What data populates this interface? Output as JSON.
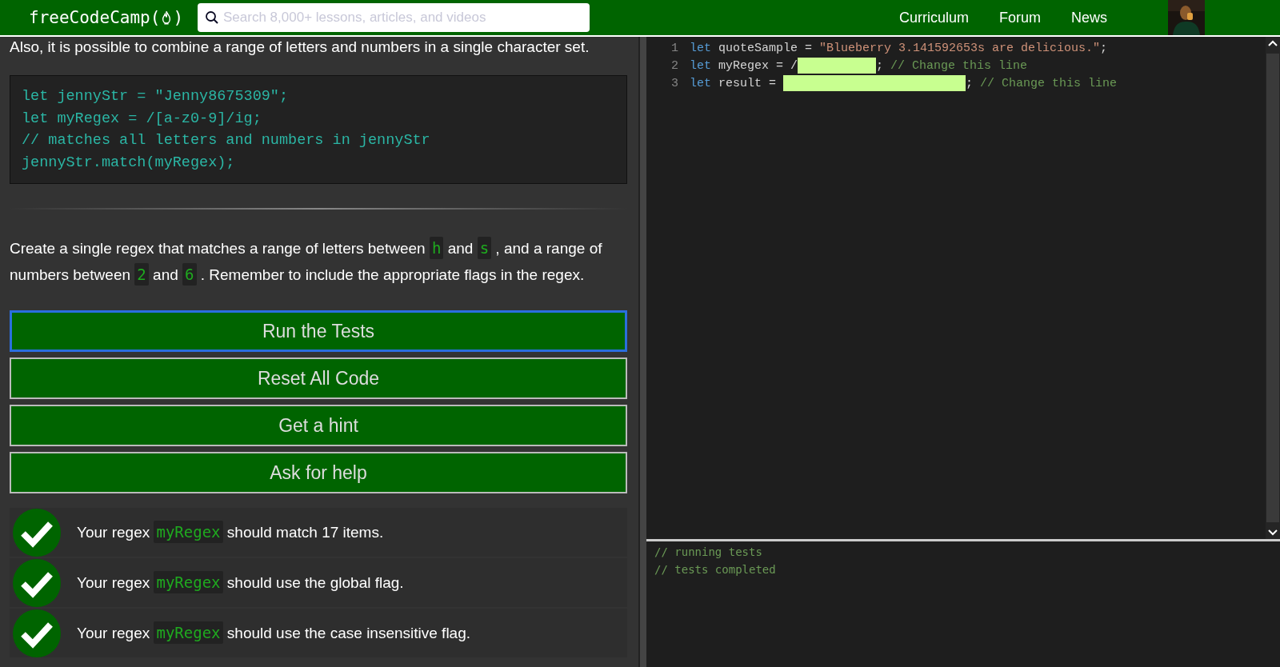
{
  "header": {
    "logo": "freeCodeCamp(",
    "logo_end": ")",
    "search": {
      "placeholder": "Search 8,000+ lessons, articles, and videos"
    },
    "nav": [
      "Curriculum",
      "Forum",
      "News"
    ]
  },
  "lesson": {
    "intro": "Also, it is possible to combine a range of letters and numbers in a single character set.",
    "example": [
      "let jennyStr = \"Jenny8675309\";",
      "let myRegex = /[a-z0-9]/ig;",
      "// matches all letters and numbers in jennyStr",
      "jennyStr.match(myRegex);"
    ],
    "instructions": [
      {
        "kind": "text",
        "text": "Create a single regex that matches a range of letters between "
      },
      {
        "kind": "code",
        "text": "h"
      },
      {
        "kind": "text",
        "text": " and "
      },
      {
        "kind": "code",
        "text": "s"
      },
      {
        "kind": "text",
        "text": " , and a range of numbers between "
      },
      {
        "kind": "code",
        "text": "2"
      },
      {
        "kind": "text",
        "text": " and "
      },
      {
        "kind": "code",
        "text": "6"
      },
      {
        "kind": "text",
        "text": " . Remember to include the appropriate flags in the regex."
      }
    ],
    "buttons": [
      {
        "label": "Run the Tests",
        "focused": true
      },
      {
        "label": "Reset All Code",
        "focused": false
      },
      {
        "label": "Get a hint",
        "focused": false
      },
      {
        "label": "Ask for help",
        "focused": false
      }
    ],
    "tests": [
      {
        "passed": true,
        "parts": [
          {
            "kind": "text",
            "text": "Your regex "
          },
          {
            "kind": "code",
            "text": "myRegex"
          },
          {
            "kind": "text",
            "text": " should match 17 items."
          }
        ]
      },
      {
        "passed": true,
        "parts": [
          {
            "kind": "text",
            "text": "Your regex "
          },
          {
            "kind": "code",
            "text": "myRegex"
          },
          {
            "kind": "text",
            "text": " should use the global flag."
          }
        ]
      },
      {
        "passed": true,
        "parts": [
          {
            "kind": "text",
            "text": "Your regex "
          },
          {
            "kind": "code",
            "text": "myRegex"
          },
          {
            "kind": "text",
            "text": " should use the case insensitive flag."
          }
        ]
      }
    ]
  },
  "editor": {
    "lines": [
      {
        "number": "1",
        "tokens": [
          {
            "kind": "keyword",
            "text": "let"
          },
          {
            "kind": "plain",
            "text": " quoteSample = "
          },
          {
            "kind": "string",
            "text": "\"Blueberry 3.141592653s are delicious.\""
          },
          {
            "kind": "plain",
            "text": ";"
          }
        ]
      },
      {
        "number": "2",
        "tokens": [
          {
            "kind": "keyword",
            "text": "let"
          },
          {
            "kind": "plain",
            "text": " myRegex = /"
          },
          {
            "kind": "shortmask"
          },
          {
            "kind": "plain",
            "text": "; "
          },
          {
            "kind": "comment",
            "text": "// Change this line"
          }
        ]
      },
      {
        "number": "3",
        "tokens": [
          {
            "kind": "keyword",
            "text": "let"
          },
          {
            "kind": "plain",
            "text": " result = "
          },
          {
            "kind": "longmask"
          },
          {
            "kind": "plain",
            "text": "; "
          },
          {
            "kind": "comment",
            "text": "// Change this line"
          }
        ]
      }
    ]
  },
  "console": [
    "// running tests",
    "// tests completed"
  ]
}
